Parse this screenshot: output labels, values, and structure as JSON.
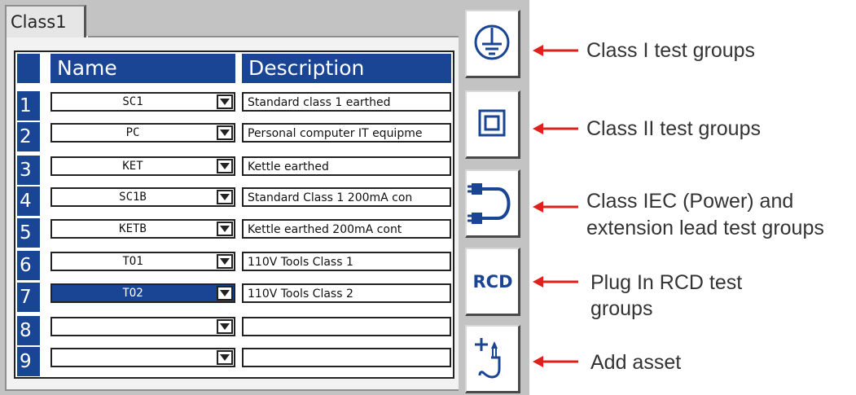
{
  "tab": {
    "label": "Class1"
  },
  "table": {
    "headers": {
      "name": "Name",
      "description": "Description"
    },
    "rows": [
      {
        "num": "1",
        "name": "SC1",
        "description": "Standard class 1 earthed"
      },
      {
        "num": "2",
        "name": "PC",
        "description": "Personal computer IT equipme"
      },
      {
        "num": "3",
        "name": "KET",
        "description": "Kettle earthed"
      },
      {
        "num": "4",
        "name": "SC1B",
        "description": "Standard Class 1 200mA con"
      },
      {
        "num": "5",
        "name": "KETB",
        "description": "Kettle earthed 200mA cont"
      },
      {
        "num": "6",
        "name": "TO1",
        "description": "110V Tools Class 1"
      },
      {
        "num": "7",
        "name": "TO2",
        "description": "110V Tools Class 2"
      },
      {
        "num": "8",
        "name": "",
        "description": ""
      },
      {
        "num": "9",
        "name": "",
        "description": ""
      }
    ],
    "selected_row": "7"
  },
  "side_buttons": [
    {
      "icon": "earth-ground-icon"
    },
    {
      "icon": "double-square-icon"
    },
    {
      "icon": "iec-lead-icon"
    },
    {
      "icon": "rcd-icon",
      "label": "RCD"
    },
    {
      "icon": "add-asset-icon"
    }
  ],
  "callouts": [
    "Class I test groups",
    "Class II test groups",
    "Class IEC (Power) and",
    "extension lead test groups",
    "Plug In RCD test",
    "groups",
    "Add asset"
  ],
  "colors": {
    "header_blue": "#1a4594",
    "arrow_red": "#e0201b",
    "panel_gray": "#c3c3c3"
  }
}
